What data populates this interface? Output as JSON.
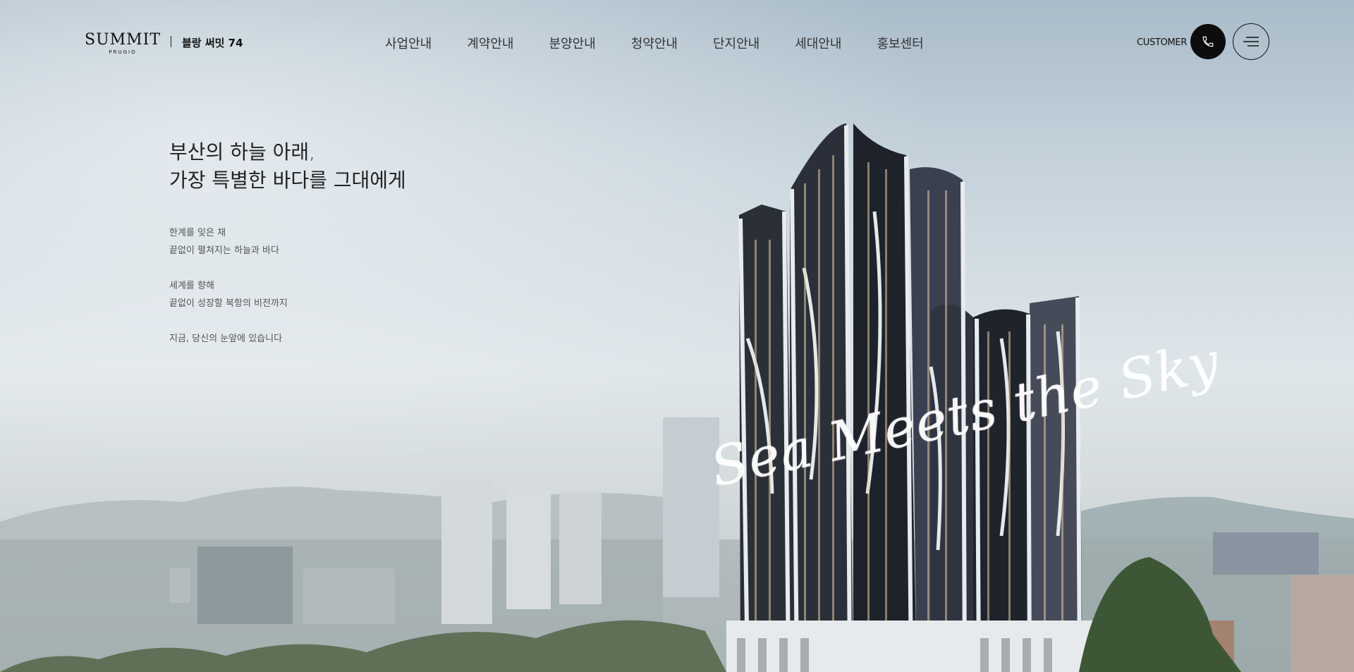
{
  "brand": {
    "logo": "SUMMIT",
    "logo_sub": "PRUGIO",
    "name": "블랑 써밋 74"
  },
  "nav": [
    {
      "label": "사업안내"
    },
    {
      "label": "계약안내"
    },
    {
      "label": "분양안내"
    },
    {
      "label": "청약안내"
    },
    {
      "label": "단지안내"
    },
    {
      "label": "세대안내"
    },
    {
      "label": "홍보센터"
    }
  ],
  "header": {
    "customer_label": "CUSTOMER",
    "phone_icon": "phone-icon",
    "menu_icon": "hamburger-menu-icon"
  },
  "hero": {
    "headline_line1": "부산의 하늘 아래,",
    "headline_line2": "가장 특별한 바다를 그대에게",
    "para1_line1": "한계를 잊은 채",
    "para1_line2": "끝없이 펼쳐지는 하늘과 바다",
    "para2_line1": "세계를 향해",
    "para2_line2": "끝없이 성장할 북항의 비전까지",
    "para3_line1": "지금, 당신의 눈앞에 있습니다",
    "tagline": "Sea Meets the Sky"
  }
}
